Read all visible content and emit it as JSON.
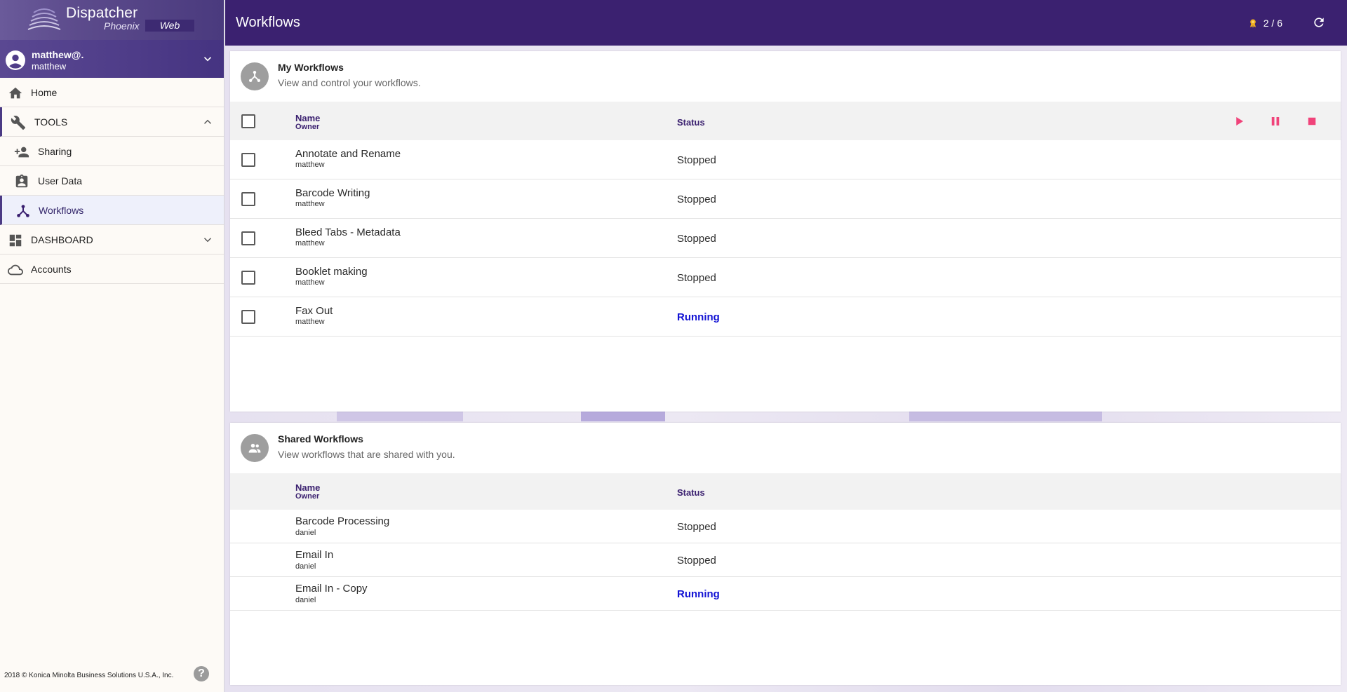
{
  "app": {
    "logo_title": "Dispatcher",
    "logo_subtitle": "Phoenix",
    "logo_badge": "Web"
  },
  "user": {
    "name": "matthew@.",
    "subname": "matthew"
  },
  "sidebar": {
    "home": "Home",
    "tools": "TOOLS",
    "sharing": "Sharing",
    "user_data": "User Data",
    "workflows": "Workflows",
    "dashboard": "DASHBOARD",
    "accounts": "Accounts",
    "copyright": "2018 © Konica Minolta Business Solutions U.S.A., Inc.",
    "help": "?"
  },
  "header": {
    "title": "Workflows",
    "license": "2 / 6"
  },
  "my_workflows": {
    "title": "My Workflows",
    "subtitle": "View and control your workflows.",
    "col_name": "Name",
    "col_owner": "Owner",
    "col_status": "Status",
    "rows": [
      {
        "name": "Annotate and Rename",
        "owner": "matthew",
        "status": "Stopped"
      },
      {
        "name": "Barcode Writing",
        "owner": "matthew",
        "status": "Stopped"
      },
      {
        "name": "Bleed Tabs - Metadata",
        "owner": "matthew",
        "status": "Stopped"
      },
      {
        "name": "Booklet making",
        "owner": "matthew",
        "status": "Stopped"
      },
      {
        "name": "Fax Out",
        "owner": "matthew",
        "status": "Running"
      }
    ]
  },
  "shared_workflows": {
    "title": "Shared Workflows",
    "subtitle": "View workflows that are shared with you.",
    "col_name": "Name",
    "col_owner": "Owner",
    "col_status": "Status",
    "rows": [
      {
        "name": "Barcode Processing",
        "owner": "daniel",
        "status": "Stopped"
      },
      {
        "name": "Email In",
        "owner": "daniel",
        "status": "Stopped"
      },
      {
        "name": "Email In - Copy",
        "owner": "daniel",
        "status": "Running"
      }
    ]
  },
  "colors": {
    "brand_purple": "#3b2170",
    "control_pink": "#f0437a",
    "running_blue": "#1212d4"
  },
  "icons": {
    "home": "home-icon",
    "tools": "wrench-icon",
    "sharing": "person-add-icon",
    "user_data": "badge-icon",
    "workflows": "workflow-icon",
    "dashboard": "dashboard-icon",
    "accounts": "cloud-icon",
    "play": "play-icon",
    "pause": "pause-icon",
    "stop": "stop-icon",
    "refresh": "refresh-icon",
    "license": "award-icon"
  }
}
